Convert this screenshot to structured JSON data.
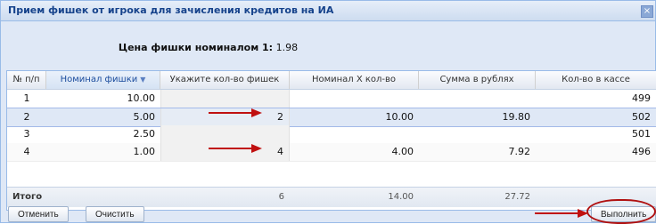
{
  "window": {
    "title": "Прием фишек от игрока для зачисления кредитов на ИА",
    "close_label": "×"
  },
  "price": {
    "label": "Цена фишки номиналом 1:",
    "value": "1.98"
  },
  "columns": [
    "№ п/п",
    "Номинал фишки",
    "Укажите кол-во фишек",
    "Номинал Х кол-во",
    "Сумма в рублях",
    "Кол-во в кассе"
  ],
  "sorted_icon": "sort-down-icon",
  "rows": [
    {
      "n": "1",
      "nominal": "10.00",
      "count": "",
      "product": "",
      "sum": "",
      "cash": "499"
    },
    {
      "n": "2",
      "nominal": "5.00",
      "count": "2",
      "product": "10.00",
      "sum": "19.80",
      "cash": "502"
    },
    {
      "n": "3",
      "nominal": "2.50",
      "count": "",
      "product": "",
      "sum": "",
      "cash": "501"
    },
    {
      "n": "4",
      "nominal": "1.00",
      "count": "4",
      "product": "4.00",
      "sum": "7.92",
      "cash": "496"
    }
  ],
  "totals": {
    "label": "Итого",
    "count": "6",
    "product": "14.00",
    "sum": "27.72"
  },
  "buttons": {
    "cancel": "Отменить",
    "clear": "Очистить",
    "execute": "Выполнить"
  },
  "colors": {
    "arrow": "#c01010",
    "header_text": "#15428b",
    "accent": "#99bbe8"
  }
}
